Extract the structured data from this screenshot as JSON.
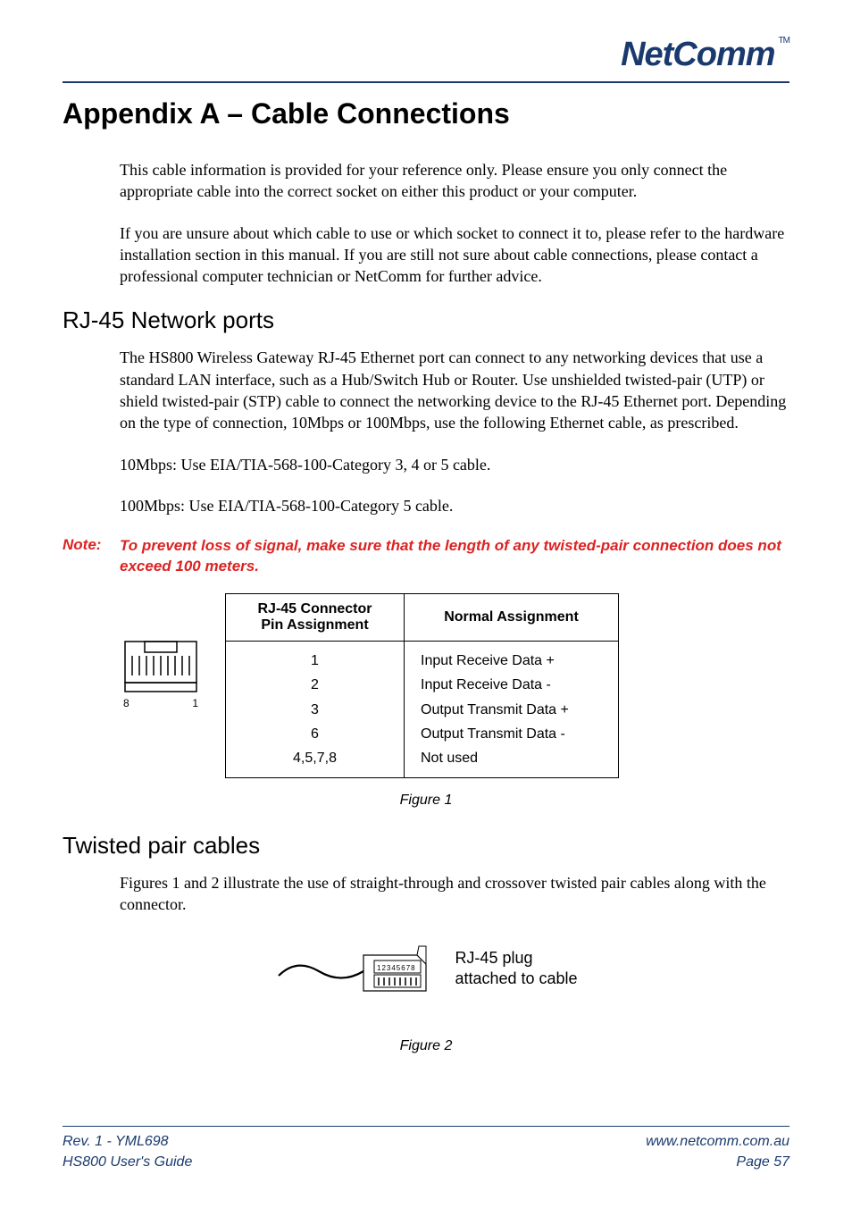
{
  "logo": {
    "text": "NetComm",
    "tm": "TM"
  },
  "title": "Appendix A – Cable Connections",
  "intro": {
    "p1": "This cable information is provided for your reference only.  Please ensure you only connect the appropriate cable into the correct socket on either this product or your computer.",
    "p2": "If you are unsure about which cable to use or which socket to connect it to, please refer to the hardware installation section in this manual. If you are still not sure about cable connections, please contact a professional computer technician or NetComm for further advice."
  },
  "section_rj45": {
    "heading": "RJ-45 Network ports",
    "p1": "The HS800 Wireless Gateway RJ-45 Ethernet port can connect to any networking devices that use a standard LAN interface, such as a Hub/Switch Hub or Router. Use unshielded twisted-pair (UTP) or shield twisted-pair (STP) cable to connect the networking device to the RJ-45 Ethernet port.   Depending on the type of connection, 10Mbps or 100Mbps, use the following Ethernet cable, as prescribed.",
    "p2": "10Mbps: Use EIA/TIA-568-100-Category 3, 4 or 5 cable.",
    "p3": "100Mbps: Use EIA/TIA-568-100-Category 5 cable."
  },
  "note": {
    "label": "Note:",
    "text": "To prevent loss of signal, make sure that the length of any twisted-pair connection does not exceed 100 meters."
  },
  "pin_table": {
    "header": {
      "col1_line1": "RJ-45 Connector",
      "col1_line2": "Pin Assignment",
      "col2": "Normal Assignment"
    },
    "rows": [
      {
        "pin": "1",
        "assign": "Input Receive Data +"
      },
      {
        "pin": "2",
        "assign": "Input Receive Data -"
      },
      {
        "pin": "3",
        "assign": "Output Transmit Data +"
      },
      {
        "pin": "6",
        "assign": "Output Transmit Data -"
      },
      {
        "pin": "4,5,7,8",
        "assign": "Not used"
      }
    ]
  },
  "connector_labels": {
    "left": "8",
    "right": "1"
  },
  "fig1_caption": "Figure 1",
  "section_twisted": {
    "heading": "Twisted pair cables",
    "p1": "Figures 1 and 2 illustrate the use of straight-through and crossover twisted pair cables along with the connector."
  },
  "plug_fig": {
    "label_line1": "RJ-45 plug",
    "label_line2": "attached to cable",
    "pin_numbers": "12345678"
  },
  "fig2_caption": "Figure 2",
  "footer": {
    "left_line1": "Rev. 1 - YML698",
    "left_line2": "HS800 User's Guide",
    "right_line1": "www.netcomm.com.au",
    "right_line2": "Page 57"
  }
}
